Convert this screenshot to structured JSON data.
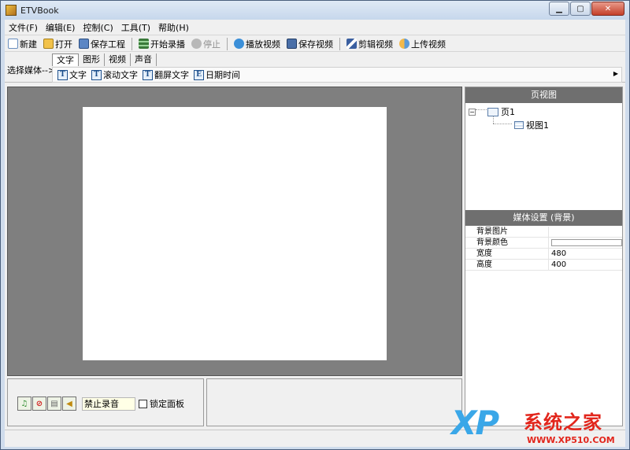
{
  "window": {
    "title": "ETVBook"
  },
  "menu": [
    "文件(F)",
    "编辑(E)",
    "控制(C)",
    "工具(T)",
    "帮助(H)"
  ],
  "toolbar": {
    "new": "新建",
    "open": "打开",
    "save_project": "保存工程",
    "start_record": "开始录播",
    "stop": "停止",
    "play_video": "播放视频",
    "save_video": "保存视频",
    "edit_video": "剪辑视频",
    "upload_video": "上传视频"
  },
  "media": {
    "select_label": "选择媒体-->",
    "tabs": [
      "文字",
      "图形",
      "视频",
      "声音"
    ],
    "tools": [
      "文字",
      "滚动文字",
      "翻屏文字",
      "日期时间"
    ]
  },
  "page_view": {
    "header": "页视图",
    "page_node": "页1",
    "view_node": "视图1"
  },
  "media_settings": {
    "header": "媒体设置 (背景)",
    "rows": [
      {
        "name": "背景图片",
        "value": ""
      },
      {
        "name": "背景颜色",
        "value": ""
      },
      {
        "name": "宽度",
        "value": "480"
      },
      {
        "name": "高度",
        "value": "400"
      }
    ],
    "bg_color": "#ffffff"
  },
  "controls": {
    "record_field": "禁止录音",
    "lock_panel": "锁定面板"
  },
  "watermark": {
    "brand": "系统之家",
    "url": "WWW.XP510.COM",
    "logo": "XP"
  }
}
